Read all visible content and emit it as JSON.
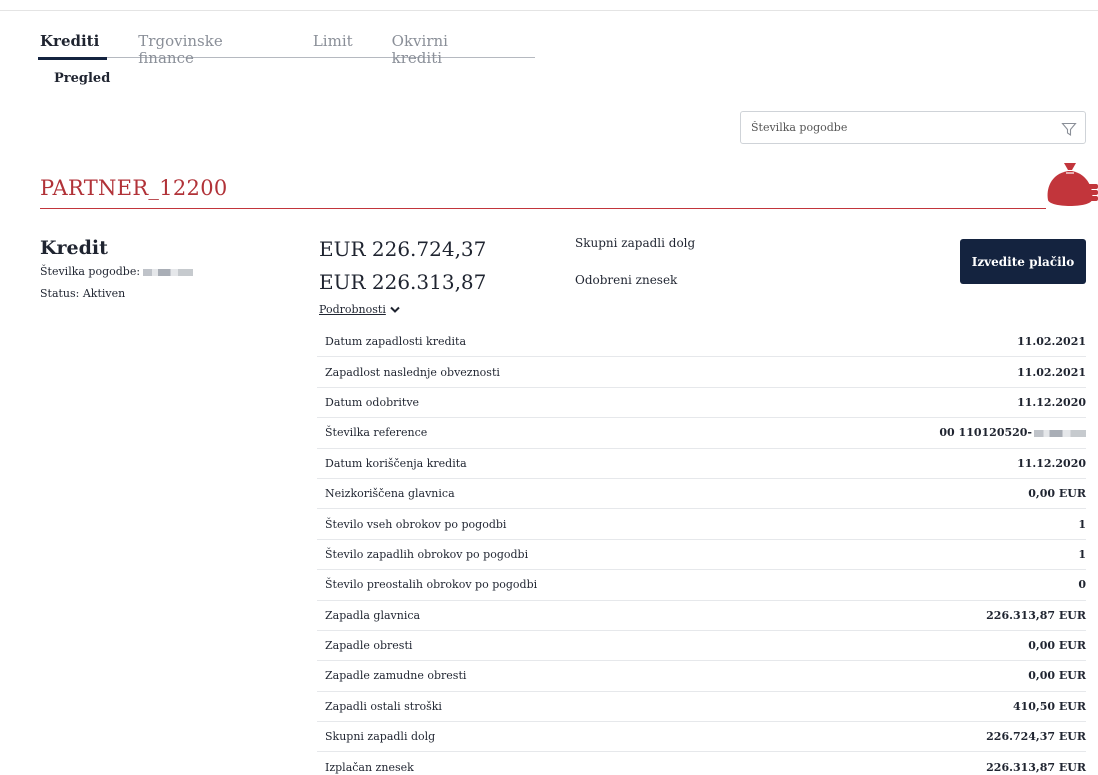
{
  "tabs": [
    {
      "label": "Krediti",
      "active": true
    },
    {
      "label": "Trgovinske finance",
      "active": false
    },
    {
      "label": "Limit",
      "active": false
    },
    {
      "label": "Okvirni krediti",
      "active": false
    }
  ],
  "subtab": "Pregled",
  "filter": {
    "placeholder": "Številka pogodbe"
  },
  "partner_name": "PARTNER_12200",
  "loan": {
    "title": "Kredit",
    "contract_label": "Številka pogodbe:",
    "status": "Status: Aktiven",
    "amount_due": "EUR 226.724,37",
    "amount_approved": "EUR 226.313,87",
    "amount_due_label": "Skupni zapadli dolg",
    "amount_approved_label": "Odobreni znesek",
    "details_link": "Podrobnosti",
    "pay_button": "Izvedite plačilo"
  },
  "details": [
    {
      "label": "Datum zapadlosti kredita",
      "value": "11.02.2021"
    },
    {
      "label": "Zapadlost naslednje obveznosti",
      "value": "11.02.2021"
    },
    {
      "label": "Datum odobritve",
      "value": "11.12.2020"
    },
    {
      "label": "Številka reference",
      "value": "00 110120520-"
    },
    {
      "label": "Datum koriščenja kredita",
      "value": "11.12.2020"
    },
    {
      "label": "Neizkoriščena glavnica",
      "value": "0,00 EUR"
    },
    {
      "label": "Število vseh obrokov po pogodbi",
      "value": "1"
    },
    {
      "label": "Število zapadlih obrokov po pogodbi",
      "value": "1"
    },
    {
      "label": "Število preostalih obrokov po pogodbi",
      "value": "0"
    },
    {
      "label": "Zapadla glavnica",
      "value": "226.313,87 EUR"
    },
    {
      "label": "Zapadle obresti",
      "value": "0,00 EUR"
    },
    {
      "label": "Zapadle zamudne obresti",
      "value": "0,00 EUR"
    },
    {
      "label": "Zapadli ostali stroški",
      "value": "410,50 EUR"
    },
    {
      "label": "Skupni zapadli dolg",
      "value": "226.724,37 EUR"
    },
    {
      "label": "Izplačan znesek",
      "value": "226.313,87 EUR"
    }
  ],
  "colors": {
    "accent_red": "#b13238",
    "navy": "#14233f"
  },
  "icons": {
    "filter": "funnel-icon",
    "bag": "money-bag-icon",
    "chevron": "chevron-down-icon"
  }
}
